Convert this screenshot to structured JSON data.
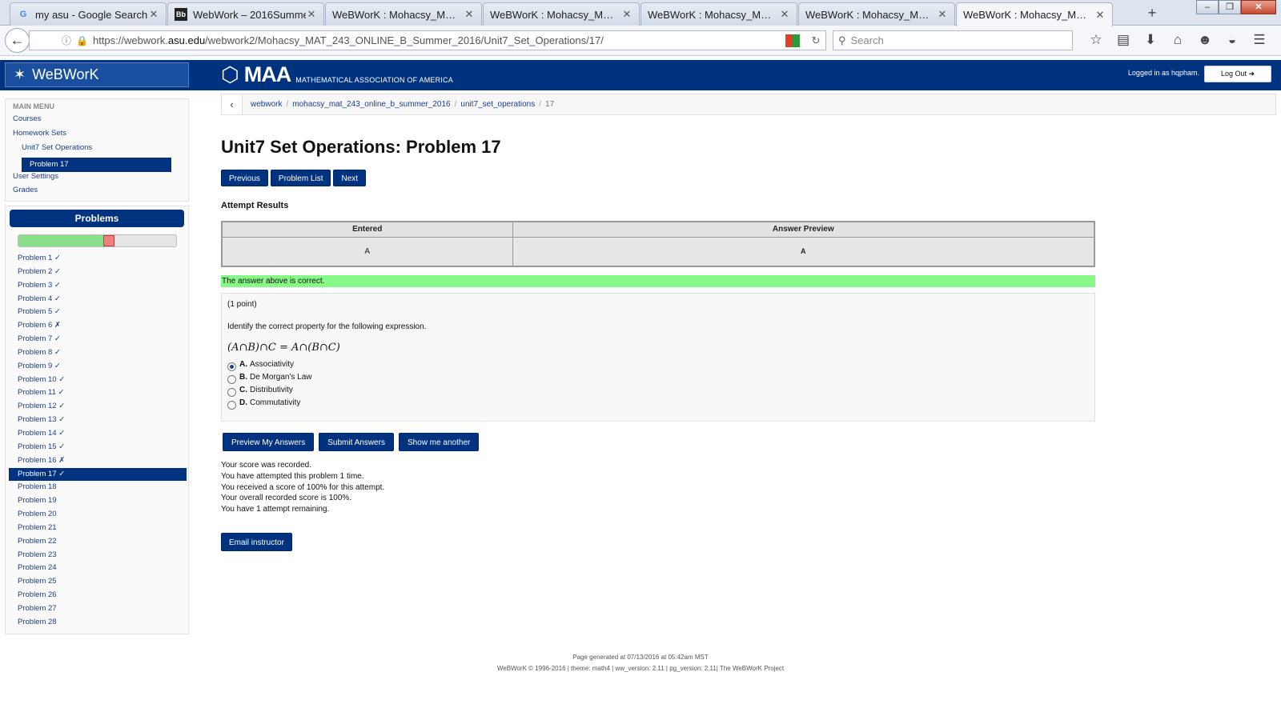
{
  "browser": {
    "tabs": [
      {
        "title": "my asu - Google Search",
        "icon": "google-icon"
      },
      {
        "title": "WebWork – 2016Summer…",
        "icon": "bb-icon"
      },
      {
        "title": "WeBWorK : Mohacsy_M…",
        "icon": "none"
      },
      {
        "title": "WeBWorK : Mohacsy_M…",
        "icon": "none"
      },
      {
        "title": "WeBWorK : Mohacsy_M…",
        "icon": "none"
      },
      {
        "title": "WeBWorK : Mohacsy_M…",
        "icon": "none"
      },
      {
        "title": "WeBWorK : Mohacsy_M…",
        "icon": "none"
      }
    ],
    "url_prefix": "https://webwork.",
    "url_domain": "asu.edu",
    "url_suffix": "/webwork2/Mohacsy_MAT_243_ONLINE_B_Summer_2016/Unit7_Set_Operations/17/",
    "search_placeholder": "Search"
  },
  "header": {
    "brand": "WeBWorK",
    "maa_abbr": "MAA",
    "maa_full": "MATHEMATICAL ASSOCIATION OF AMERICA",
    "logged_in": "Logged in as hqpham.",
    "logout": "Log Out"
  },
  "sidebar": {
    "menu_title": "MAIN MENU",
    "courses": "Courses",
    "homework_sets": "Homework Sets",
    "set_name": "Unit7 Set Operations",
    "current_problem": "Problem 17",
    "user_settings": "User Settings",
    "grades": "Grades"
  },
  "problems_panel": {
    "title": "Problems",
    "progress_correct_fraction": 0.54,
    "progress_incorrect_fraction": 0.07,
    "items": [
      "Problem 1 ✓",
      "Problem 2 ✓",
      "Problem 3 ✓",
      "Problem 4 ✓",
      "Problem 5 ✓",
      "Problem 6 ✗",
      "Problem 7 ✓",
      "Problem 8 ✓",
      "Problem 9 ✓",
      "Problem 10 ✓",
      "Problem 11 ✓",
      "Problem 12 ✓",
      "Problem 13 ✓",
      "Problem 14 ✓",
      "Problem 15 ✓",
      "Problem 16 ✗",
      "Problem 17 ✓",
      "Problem 18",
      "Problem 19",
      "Problem 20",
      "Problem 21",
      "Problem 22",
      "Problem 23",
      "Problem 24",
      "Problem 25",
      "Problem 26",
      "Problem 27",
      "Problem 28"
    ],
    "active_index": 16
  },
  "breadcrumb": {
    "items": [
      "webwork",
      "mohacsy_mat_243_online_b_summer_2016",
      "unit7_set_operations"
    ],
    "current": "17",
    "separator": "/"
  },
  "main": {
    "title": "Unit7 Set Operations: Problem 17",
    "nav_previous": "Previous",
    "nav_problem_list": "Problem List",
    "nav_next": "Next",
    "attempt_results": "Attempt Results",
    "table_headers": [
      "Entered",
      "Answer Preview"
    ],
    "table_row": [
      "A",
      "A"
    ],
    "correct_message": "The answer above is correct.",
    "points": "(1 point)",
    "question": "Identify the correct property for the following expression.",
    "expression": "(A∩B)∩C = A∩(B∩C)",
    "options": [
      {
        "letter": "A.",
        "label": "Associativity",
        "selected": true
      },
      {
        "letter": "B.",
        "label": "De Morgan's Law",
        "selected": false
      },
      {
        "letter": "C.",
        "label": "Distributivity",
        "selected": false
      },
      {
        "letter": "D.",
        "label": "Commutativity",
        "selected": false
      }
    ],
    "btn_preview": "Preview My Answers",
    "btn_submit": "Submit Answers",
    "btn_another": "Show me another",
    "messages": [
      "Your score was recorded.",
      "You have attempted this problem 1 time.",
      "You received a score of 100% for this attempt.",
      "Your overall recorded score is 100%.",
      "You have 1 attempt remaining."
    ],
    "email_instructor": "Email instructor"
  },
  "footer": {
    "line1": "Page generated at 07/13/2016 at 05:42am MST",
    "line2": "WeBWorK © 1996-2016 | theme: math4 | ww_version: 2.11 | pg_version: 2.11| The WeBWorK Project"
  },
  "colors": {
    "header_blue": "#00337f",
    "correct_green": "#88f888",
    "link": "#1a3e8c"
  }
}
